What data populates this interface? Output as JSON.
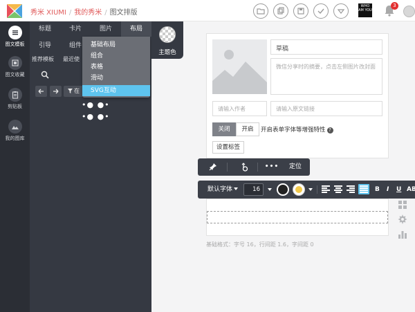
{
  "topbar": {
    "brand": "秀米 XIUMI",
    "breadcrumbs": [
      "我的秀米",
      "图文排版"
    ],
    "separator": "/",
    "qr_text": "WHO AM YOU",
    "notification_count": "3"
  },
  "leftnav": {
    "items": [
      {
        "label": "图文模板",
        "icon": "list-icon"
      },
      {
        "label": "图文收藏",
        "icon": "collection-icon"
      },
      {
        "label": "剪贴板",
        "icon": "clipboard-icon"
      },
      {
        "label": "我的图库",
        "icon": "image-library-icon"
      }
    ]
  },
  "panel": {
    "tabs": [
      "标题",
      "卡片",
      "图片",
      "布局"
    ],
    "active_tab": "布局",
    "row2": [
      "引导",
      "组件"
    ],
    "row3": [
      "推荐模板",
      "最近使"
    ],
    "filter_label": "在"
  },
  "dropdown": {
    "items": [
      "基础布局",
      "组合",
      "表格",
      "滑动",
      "SVG互动"
    ],
    "active_item": "SVG互动"
  },
  "theme": {
    "label": "主题色"
  },
  "card": {
    "title_value": "草稿",
    "summary_placeholder": "微信分享时的摘要，点击左侧图片改封面",
    "author_placeholder": "请输入作者",
    "link_placeholder": "请输入原文链接",
    "toggle_off": "关闭",
    "toggle_on": "开启",
    "toggle_desc": "开启表单字体等增强特性",
    "help": "?",
    "tag_button": "设置标签"
  },
  "toolbar1": {
    "position_label": "定位",
    "more": "• • •"
  },
  "toolbar2": {
    "font_label": "默认字体",
    "font_size": "16",
    "bold": "B",
    "italic": "I",
    "underline": "U",
    "more": "AB"
  },
  "footer": {
    "basic_format": "基础格式：字号 16，行间距 1.6，字间距 0"
  },
  "colors": {
    "accent": "#5ec4ee",
    "nav_bg": "#2b2e35",
    "panel_bg": "#353942",
    "brand_red": "#e05a5a"
  }
}
